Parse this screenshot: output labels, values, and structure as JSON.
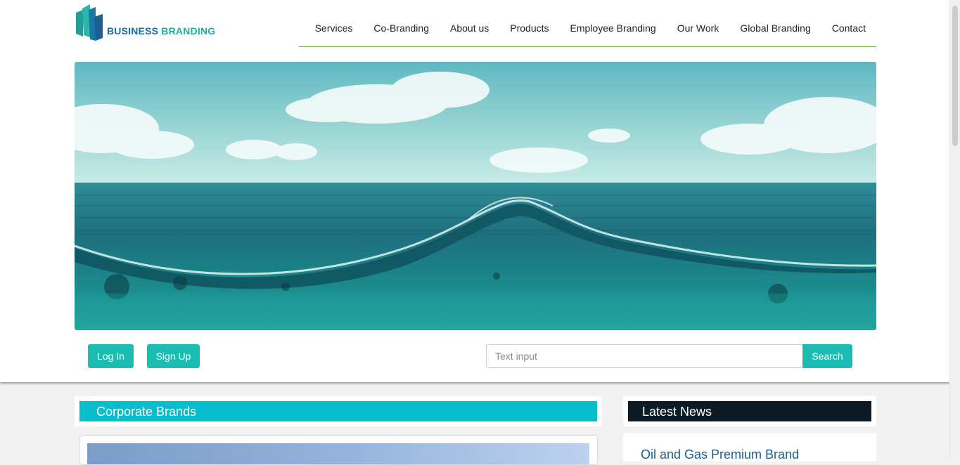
{
  "brand": {
    "logo_word1": "BUSINESS",
    "logo_word2": "BRANDING",
    "logo_icon": "stacked-bars-logo-icon",
    "colors": {
      "teal": "#23a9a0",
      "blue": "#1c6c9e"
    }
  },
  "nav": {
    "items": [
      {
        "label": "Services"
      },
      {
        "label": "Co-Branding"
      },
      {
        "label": "About us"
      },
      {
        "label": "Products"
      },
      {
        "label": "Employee Branding"
      },
      {
        "label": "Our Work"
      },
      {
        "label": "Global Branding"
      },
      {
        "label": "Contact"
      }
    ],
    "underline_color": "#6cb33e"
  },
  "hero": {
    "image": "ocean-wave-banner"
  },
  "auth": {
    "login_label": "Log In",
    "signup_label": "Sign Up"
  },
  "search": {
    "placeholder": "Text input",
    "button_label": "Search"
  },
  "accent_color": "#1cbcb3",
  "corporate_brands": {
    "title": "Corporate Brands",
    "bar_color": "#09becc"
  },
  "latest_news": {
    "title": "Latest News",
    "bar_color": "#0d1b24",
    "items": [
      {
        "headline": "Oil and Gas Premium Brand"
      }
    ]
  }
}
